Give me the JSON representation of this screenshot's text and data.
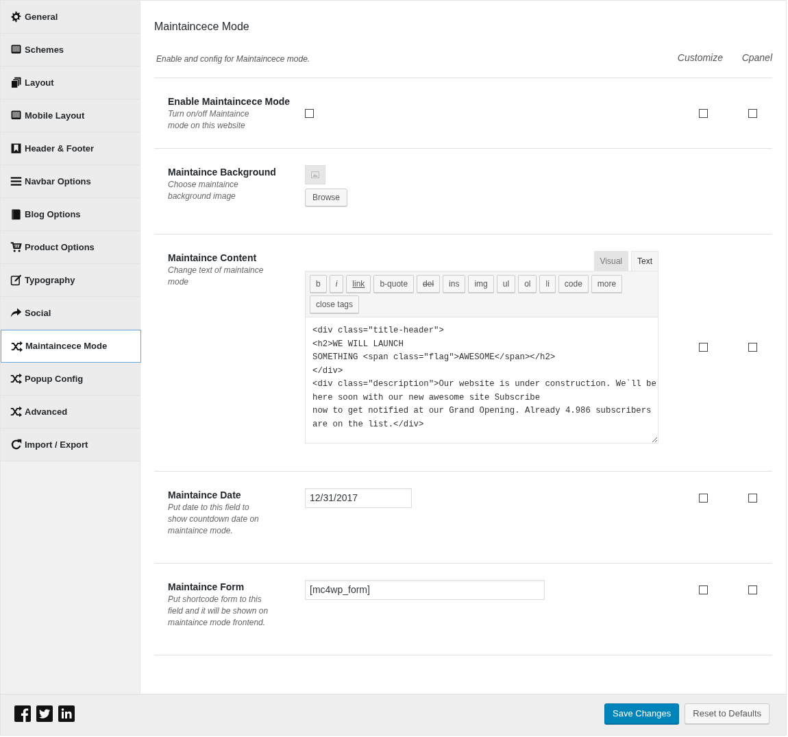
{
  "sidebar": {
    "items": [
      {
        "label": "General",
        "selected": false
      },
      {
        "label": "Schemes",
        "selected": false
      },
      {
        "label": "Layout",
        "selected": false
      },
      {
        "label": "Mobile Layout",
        "selected": false
      },
      {
        "label": "Header & Footer",
        "selected": false
      },
      {
        "label": "Navbar Options",
        "selected": false
      },
      {
        "label": "Blog Options",
        "selected": false
      },
      {
        "label": "Product Options",
        "selected": false
      },
      {
        "label": "Typography",
        "selected": false
      },
      {
        "label": "Social",
        "selected": false
      },
      {
        "label": "Maintaincece Mode",
        "selected": true
      },
      {
        "label": "Popup Config",
        "selected": false
      },
      {
        "label": "Advanced",
        "selected": false
      },
      {
        "label": "Import / Export",
        "selected": false
      }
    ]
  },
  "section": {
    "title": "Maintaincece Mode",
    "description": "Enable and config for Maintaincece mode.",
    "columns": [
      "Customize",
      "Cpanel"
    ]
  },
  "settings": [
    {
      "kind": "checkbox",
      "title": "Enable Maintaincece Mode",
      "description": "Turn on/off Maintaince mode on this website",
      "checked": false,
      "customize": false,
      "cpanel": false
    },
    {
      "kind": "media",
      "title": "Maintaince Background",
      "description": "Choose maintaince background image",
      "button": "Browse"
    },
    {
      "kind": "editor",
      "title": "Maintaince Content",
      "description": "Change text of maintaince mode",
      "tabs": [
        {
          "label": "Visual",
          "selected": false
        },
        {
          "label": "Text",
          "selected": true
        }
      ],
      "buttons": [
        "b",
        "i",
        "link",
        "b-quote",
        "del",
        "ins",
        "img",
        "ul",
        "ol",
        "li",
        "code",
        "more",
        "close tags"
      ],
      "value": "<div class=\"title-header\">\n<h2>WE WILL LAUNCH\nSOMETHING <span class=\"flag\">AWESOME</span></h2>\n</div>\n<div class=\"description\">Our website is under construction. We`ll be\nhere soon with our new awesome site Subscribe\nnow to get notified at our Grand Opening. Already 4.986 subscribers\nare on the list.</div>",
      "customize": false,
      "cpanel": false
    },
    {
      "kind": "text",
      "title": "Maintaince Date",
      "description": "Put date to this field to show countdown date on maintaince mode.",
      "value": "12/31/2017",
      "customize": false,
      "cpanel": false
    },
    {
      "kind": "text",
      "title": "Maintaince Form",
      "description": "Put shortcode form to this field and it will be shown on maintaince mode frontend.",
      "value": "[mc4wp_form]",
      "customize": false,
      "cpanel": false
    }
  ],
  "footer": {
    "buttons": [
      {
        "label": "Save Changes",
        "kind": "primary"
      },
      {
        "label": "Reset to Defaults",
        "kind": "secondary"
      }
    ]
  }
}
